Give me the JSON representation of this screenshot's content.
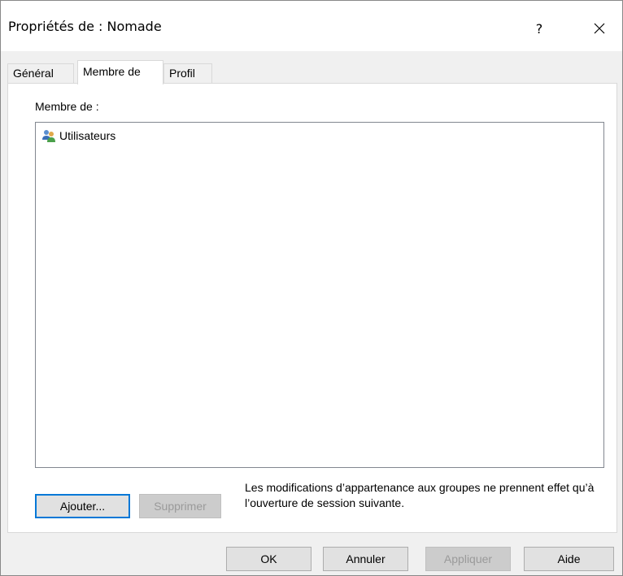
{
  "window": {
    "title": "Propriétés de : Nomade",
    "help_label": "?",
    "close_label": "✕"
  },
  "tabs": [
    {
      "label": "Général",
      "active": false
    },
    {
      "label": "Membre de",
      "active": true
    },
    {
      "label": "Profil",
      "active": false
    }
  ],
  "member_of": {
    "label": "Membre de :",
    "items": [
      {
        "name": "Utilisateurs",
        "icon": "group-icon"
      }
    ]
  },
  "actions": {
    "add_label": "Ajouter...",
    "remove_label": "Supprimer",
    "note": "Les modifications d’appartenance aux groupes ne prennent effet qu’à l’ouverture de session suivante."
  },
  "footer": {
    "ok_label": "OK",
    "cancel_label": "Annuler",
    "apply_label": "Appliquer",
    "help_label": "Aide"
  }
}
